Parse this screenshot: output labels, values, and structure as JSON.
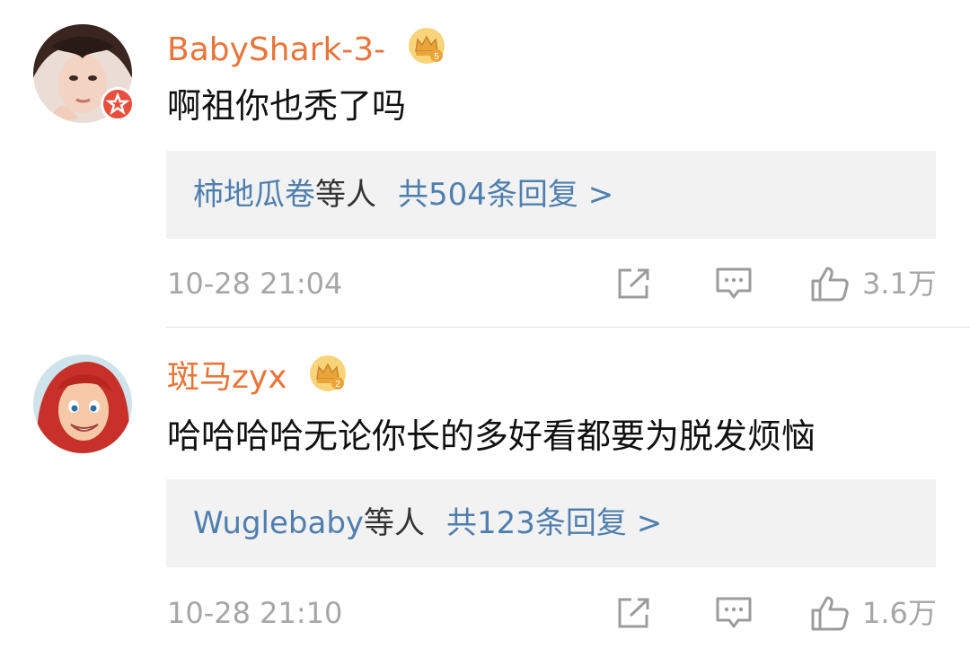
{
  "comments": [
    {
      "username": "BabyShark-3-",
      "text": "啊祖你也秃了吗",
      "reply_names": "柿地瓜卷",
      "reply_suffix": "等人",
      "reply_count": "共504条回复 >",
      "timestamp": "10-28 21:04",
      "likes": "3.1万",
      "badge": "crown-icon-v5",
      "verified": true
    },
    {
      "username": "斑马zyx",
      "text": "哈哈哈哈无论你长的多好看都要为脱发烦恼",
      "reply_names": "Wuglebaby",
      "reply_suffix": "等人",
      "reply_count": "共123条回复 >",
      "timestamp": "10-28 21:10",
      "likes": "1.6万",
      "badge": "crown-icon-v2",
      "verified": false
    }
  ],
  "colors": {
    "username": "#e8753a",
    "link": "#4f7fae",
    "meta": "#a6a6a6",
    "reply_bg": "#f2f2f2",
    "verified": "#e94e3d"
  }
}
